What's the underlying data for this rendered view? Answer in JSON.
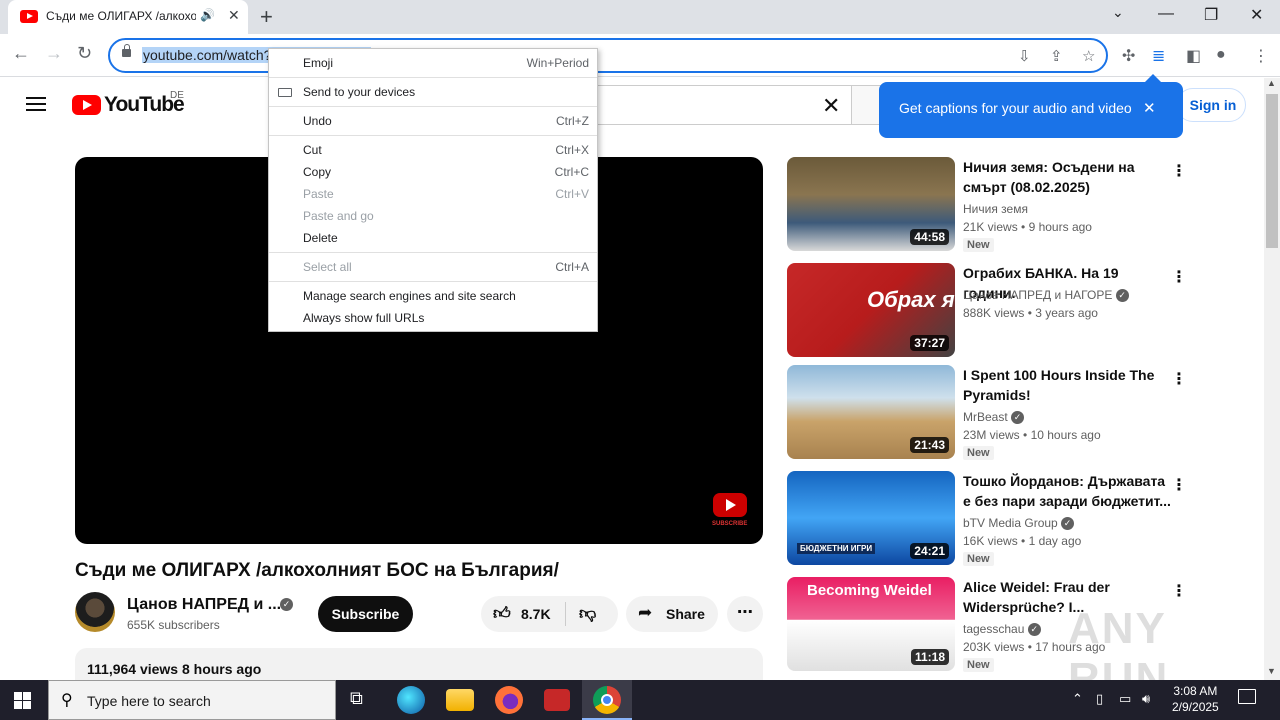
{
  "browser": {
    "tab_title": "Съди ме ОЛИГАРХ /алкохолният БОС на България/",
    "url": "youtube.com/watch?",
    "captions_tooltip": "Get captions for your audio and video"
  },
  "context_menu": {
    "items": [
      {
        "label": "Emoji",
        "shortcut": "Win+Period"
      },
      {
        "label": "Send to your devices",
        "shortcut": ""
      },
      {
        "label": "Undo",
        "shortcut": "Ctrl+Z"
      },
      {
        "label": "Cut",
        "shortcut": "Ctrl+X"
      },
      {
        "label": "Copy",
        "shortcut": "Ctrl+C"
      },
      {
        "label": "Paste",
        "shortcut": "Ctrl+V"
      },
      {
        "label": "Paste and go",
        "shortcut": ""
      },
      {
        "label": "Delete",
        "shortcut": ""
      },
      {
        "label": "Select all",
        "shortcut": "Ctrl+A"
      },
      {
        "label": "Manage search engines and site search",
        "shortcut": ""
      },
      {
        "label": "Always show full URLs",
        "shortcut": ""
      }
    ]
  },
  "youtube": {
    "logo_text": "YouTube",
    "country": "DE",
    "signin_label": "Sign in",
    "player_subscribe_text": "SUBSCRIBE"
  },
  "video": {
    "title": "Съди ме ОЛИГАРХ /алкохолният БОС на България/",
    "channel": "Цанов НАПРЕД и ...",
    "subscribers": "655K subscribers",
    "subscribe_label": "Subscribe",
    "likes": "8.7K",
    "share_label": "Share",
    "views_time": "111,964 views  8 hours ago"
  },
  "recommendations": [
    {
      "title": "Ничия земя: Осъдени на смърт (08.02.2025)",
      "channel": "Ничия земя",
      "verified": false,
      "views": "21K views",
      "age": "9 hours ago",
      "is_new": true,
      "duration": "44:58",
      "new_label": "New"
    },
    {
      "title": "Ограбих БАНКА. На 19 години.",
      "channel": "Цанов НАПРЕД и НАГОРЕ",
      "verified": true,
      "views": "888K views",
      "age": "3 years ago",
      "is_new": false,
      "duration": "37:27",
      "new_label": "",
      "thumb_text": "Обрах я!"
    },
    {
      "title": "I Spent 100 Hours Inside The Pyramids!",
      "channel": "MrBeast",
      "verified": true,
      "views": "23M views",
      "age": "10 hours ago",
      "is_new": true,
      "duration": "21:43",
      "new_label": "New"
    },
    {
      "title": "Тошко Йорданов: Държавата е без пари заради бюджетит...",
      "channel": "bTV Media Group",
      "verified": true,
      "views": "16K views",
      "age": "1 day ago",
      "is_new": true,
      "duration": "24:21",
      "new_label": "New",
      "thumb_text": "БЮДЖЕТНИ ИГРИ"
    },
    {
      "title": "Alice Weidel: Frau der Widersprüche? I...",
      "channel": "tagesschau",
      "verified": true,
      "views": "203K views",
      "age": "17 hours ago",
      "is_new": true,
      "duration": "11:18",
      "new_label": "New",
      "thumb_text": "Becoming Weidel"
    }
  ],
  "taskbar": {
    "search_placeholder": "Type here to search",
    "time": "3:08 AM",
    "date": "2/9/2025"
  },
  "watermark": "ANY RUN"
}
